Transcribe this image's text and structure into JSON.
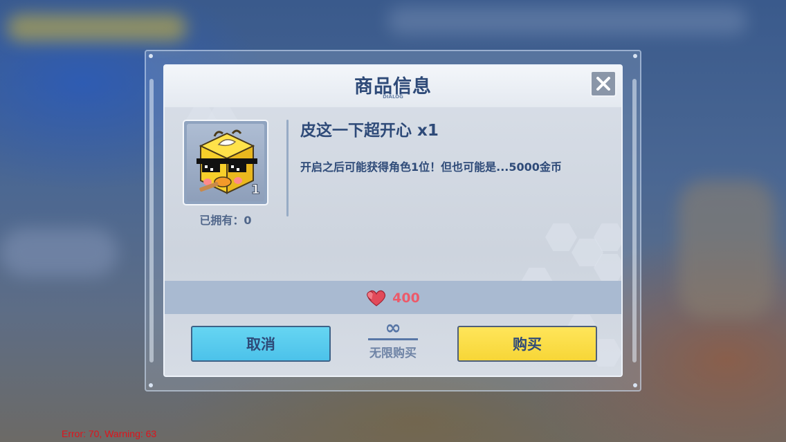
{
  "dialog": {
    "title": "商品信息",
    "subtitle": "DIALOG"
  },
  "item": {
    "name": "皮这一下超开心 x1",
    "description": "开启之后可能获得角色1位！但也可能是...5000金币",
    "count": "1",
    "owned_label": "已拥有：0",
    "icon": "duck-box-icon"
  },
  "price": {
    "currency_icon": "hearts-icon",
    "value": "400"
  },
  "purchase_limit": {
    "symbol": "∞",
    "label": "无限购买"
  },
  "buttons": {
    "cancel": "取消",
    "buy": "购买"
  },
  "console": {
    "message": "Error: 70, Warning: 63"
  },
  "colors": {
    "title": "#2e4a78",
    "cancel": "#4cc2ea",
    "buy": "#f7d637",
    "price": "#ec5a6a",
    "console": "#e0131b"
  }
}
